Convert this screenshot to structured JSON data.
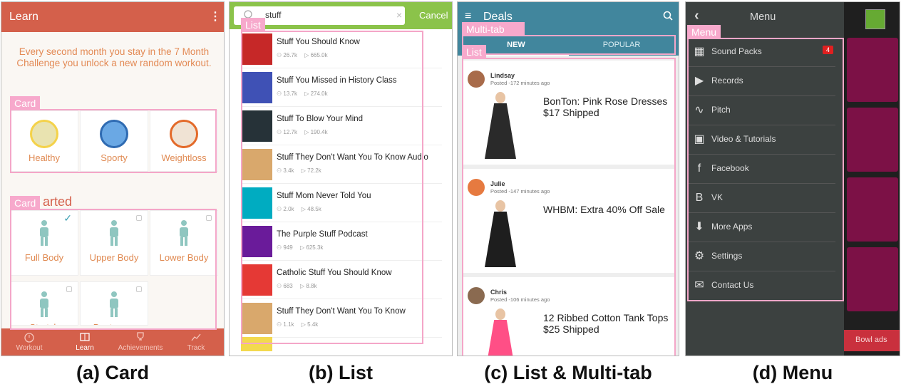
{
  "captions": {
    "a": "(a) Card",
    "b": "(b) List",
    "c": "(c) List & Multi-tab",
    "d": "(d) Menu"
  },
  "tags": {
    "card": "Card",
    "list": "List",
    "multitab": "Multi-tab",
    "menu": "Menu"
  },
  "panel_a": {
    "title": "Learn",
    "message": "Every second month you stay in the 7 Month Challenge you unlock a new random workout.",
    "section_heading_partial": "arted",
    "cards_top": [
      {
        "label": "Healthy",
        "icon": "apple-icon"
      },
      {
        "label": "Sporty",
        "icon": "sport-shoes-icon"
      },
      {
        "label": "Weightloss",
        "icon": "campfire-icon"
      }
    ],
    "cards_bottom": [
      {
        "label": "Full Body",
        "state": "checked"
      },
      {
        "label": "Upper Body",
        "state": "locked"
      },
      {
        "label": "Lower Body",
        "state": "locked"
      },
      {
        "label": "Stretch",
        "state": "locked"
      },
      {
        "label": "Bootcamp",
        "state": "locked"
      }
    ],
    "bottom_nav": [
      "Workout",
      "Learn",
      "Achievements",
      "Track"
    ]
  },
  "panel_b": {
    "search_value": "stuff",
    "cancel_label": "Cancel",
    "results": [
      {
        "name": "Stuff You Should Know",
        "subs": "26.7k",
        "plays": "665.0k",
        "color": "#c62828"
      },
      {
        "name": "Stuff You Missed in History Class",
        "subs": "13.7k",
        "plays": "274.0k",
        "color": "#3f51b5"
      },
      {
        "name": "Stuff To Blow Your Mind",
        "subs": "12.7k",
        "plays": "190.4k",
        "color": "#263238"
      },
      {
        "name": "Stuff They Don't Want You To Know Audio",
        "subs": "3.4k",
        "plays": "72.2k",
        "color": "#d9a86c"
      },
      {
        "name": "Stuff Mom Never Told You",
        "subs": "2.0k",
        "plays": "48.5k",
        "color": "#00acc1"
      },
      {
        "name": "The Purple Stuff Podcast",
        "subs": "949",
        "plays": "625.3k",
        "color": "#6a1b9a"
      },
      {
        "name": "Catholic Stuff You Should Know",
        "subs": "683",
        "plays": "8.8k",
        "color": "#e53935"
      },
      {
        "name": "Stuff They Don't Want You To Know",
        "subs": "1.1k",
        "plays": "5.4k",
        "color": "#d9a86c"
      }
    ]
  },
  "panel_c": {
    "title": "Deals",
    "tabs": [
      "NEW",
      "POPULAR"
    ],
    "deals": [
      {
        "user": "Lindsay",
        "time": "Posted -172 minutes ago",
        "text": "BonTon: Pink Rose Dresses $17 Shipped",
        "dress": "#2a2a2a"
      },
      {
        "user": "Julie",
        "time": "Posted -147 minutes ago",
        "text": "WHBM: Extra 40% Off Sale",
        "dress": "#1e1e1e"
      },
      {
        "user": "Chris",
        "time": "Posted -106 minutes ago",
        "text": "12 Ribbed Cotton Tank Tops $25 Shipped",
        "dress": "#ff4f86"
      }
    ]
  },
  "panel_d": {
    "title": "Menu",
    "items": [
      {
        "label": "Sound Packs",
        "icon": "grid-icon",
        "badge": "4"
      },
      {
        "label": "Records",
        "icon": "play-circle-icon"
      },
      {
        "label": "Pitch",
        "icon": "waveform-icon"
      },
      {
        "label": "Video & Tutorials",
        "icon": "video-icon"
      },
      {
        "label": "Facebook",
        "icon": "facebook-icon"
      },
      {
        "label": "VK",
        "icon": "vk-icon"
      },
      {
        "label": "More Apps",
        "icon": "download-icon"
      },
      {
        "label": "Settings",
        "icon": "gear-icon"
      },
      {
        "label": "Contact Us",
        "icon": "mail-icon"
      }
    ],
    "ads_text": "Bowl ads"
  }
}
